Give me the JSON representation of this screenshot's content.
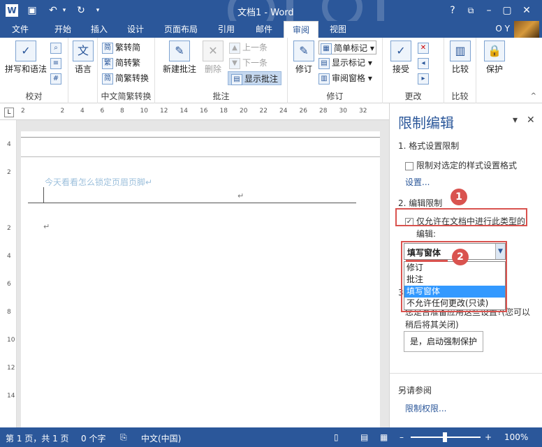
{
  "titlebar": {
    "app_icon": "W",
    "doc_title": "文档1 - Word",
    "help": "?"
  },
  "tabs": {
    "file": "文件",
    "home": "开始",
    "insert": "插入",
    "design": "设计",
    "layout": "页面布局",
    "references": "引用",
    "mailings": "邮件",
    "review": "审阅",
    "view": "视图",
    "user": "O Y"
  },
  "ribbon": {
    "proofing": {
      "spelling": "拼写和语法",
      "label": "校对"
    },
    "language": {
      "btn": "语言"
    },
    "chinese": {
      "trad": "繁转简",
      "simp": "简转繁",
      "convert": "简繁转换",
      "label": "中文简繁转换"
    },
    "comments": {
      "new": "新建批注",
      "delete": "删除",
      "prev": "上一条",
      "next": "下一条",
      "show": "显示批注",
      "label": "批注"
    },
    "tracking": {
      "track": "修订",
      "markup": "简单标记",
      "show_markup": "显示标记",
      "pane": "审阅窗格",
      "label": "修订"
    },
    "changes": {
      "accept": "接受",
      "label": "更改"
    },
    "compare": {
      "btn": "比较",
      "label": "比较"
    },
    "protect": {
      "btn": "保护"
    }
  },
  "ruler": {
    "tabstop": "L",
    "ticks": [
      "2",
      "2",
      "4",
      "6",
      "8",
      "10",
      "12",
      "14",
      "16",
      "18",
      "20",
      "22",
      "24",
      "26",
      "28",
      "30",
      "32"
    ],
    "vticks": [
      "4",
      "2",
      "",
      "2",
      "4",
      "6",
      "8",
      "10",
      "12",
      "14"
    ]
  },
  "document": {
    "header_text": "今天看看怎么锁定页眉页脚↵",
    "mark1": "↵",
    "mark2": "↵"
  },
  "pane": {
    "title": "限制编辑",
    "pin": "▾",
    "close": "✕",
    "sec1": "1. 格式设置限制",
    "format_check": "限制对选定的样式设置格式",
    "settings_link": "设置...",
    "sec2": "2. 编辑限制",
    "edit_check": "仅允许在文档中进行此类型的",
    "edit_check2": "编辑:",
    "dropdown_value": "填写窗体",
    "options": [
      "修订",
      "批注",
      "填写窗体",
      "不允许任何更改(只读)"
    ],
    "sec3_partial": "3.",
    "sec3_text1": "您是否准备应用这些设置?(您可以",
    "sec3_text2": "稍后将其关闭)",
    "start_btn": "是，启动强制保护",
    "see_also": "另请参阅",
    "link_more": "限制权限..."
  },
  "badges": {
    "one": "1",
    "two": "2"
  },
  "status": {
    "page": "第 1 页，共 1 页",
    "words": "0 个字",
    "lang": "中文(中国)",
    "zoom": "100%"
  }
}
